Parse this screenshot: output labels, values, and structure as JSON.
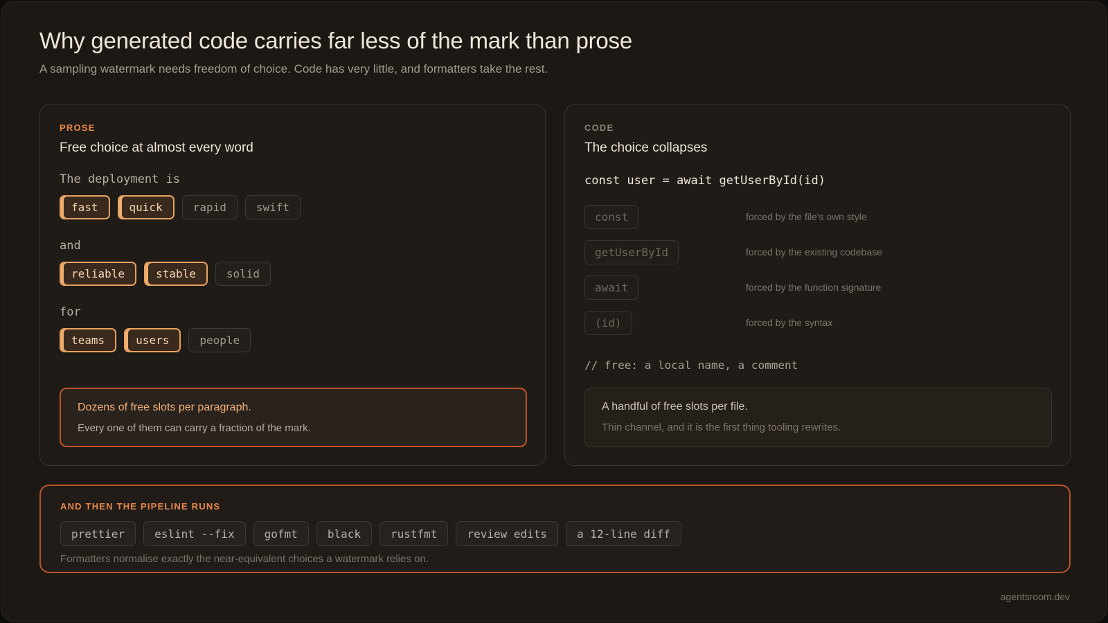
{
  "header": {
    "title": "Why generated code carries far less of the mark than prose",
    "subtitle": "A sampling watermark needs freedom of choice. Code has very little, and formatters take the rest."
  },
  "prose": {
    "kicker": "PROSE",
    "heading": "Free choice at almost every word",
    "groups": [
      {
        "lead": "The deployment is",
        "options": [
          {
            "text": "fast",
            "selected": true
          },
          {
            "text": "quick",
            "selected": true
          },
          {
            "text": "rapid",
            "selected": false
          },
          {
            "text": "swift",
            "selected": false
          }
        ]
      },
      {
        "lead": "and",
        "options": [
          {
            "text": "reliable",
            "selected": true
          },
          {
            "text": "stable",
            "selected": true
          },
          {
            "text": "solid",
            "selected": false
          }
        ]
      },
      {
        "lead": "for",
        "options": [
          {
            "text": "teams",
            "selected": true
          },
          {
            "text": "users",
            "selected": true
          },
          {
            "text": "people",
            "selected": false
          }
        ]
      }
    ],
    "callout": {
      "line1": "Dozens of free slots per paragraph.",
      "line2": "Every one of them can carry a fraction of the mark."
    }
  },
  "code": {
    "kicker": "CODE",
    "heading": "The choice collapses",
    "line": "const user = await getUserById(id)",
    "forced": [
      {
        "token": "const",
        "reason": "forced by the file's own style"
      },
      {
        "token": "getUserById",
        "reason": "forced by the existing codebase"
      },
      {
        "token": "await",
        "reason": "forced by the function signature"
      },
      {
        "token": "(id)",
        "reason": "forced by the syntax"
      }
    ],
    "comment": "// free: a local name, a comment",
    "callout": {
      "line1": "A handful of free slots per file.",
      "line2": "Thin channel, and it is the first thing tooling rewrites."
    }
  },
  "pipeline": {
    "kicker": "AND THEN THE PIPELINE RUNS",
    "tools": [
      "prettier",
      "eslint --fix",
      "gofmt",
      "black",
      "rustfmt",
      "review edits",
      "a 12-line diff"
    ],
    "note": "Formatters normalise exactly the near-equivalent choices a watermark relies on."
  },
  "footer": {
    "site": "agentsroom.dev"
  },
  "colors": {
    "background": "#1c1915",
    "accent": "#e8894a",
    "selected_border": "#e8a15f",
    "pipeline_border": "#b8532a"
  }
}
